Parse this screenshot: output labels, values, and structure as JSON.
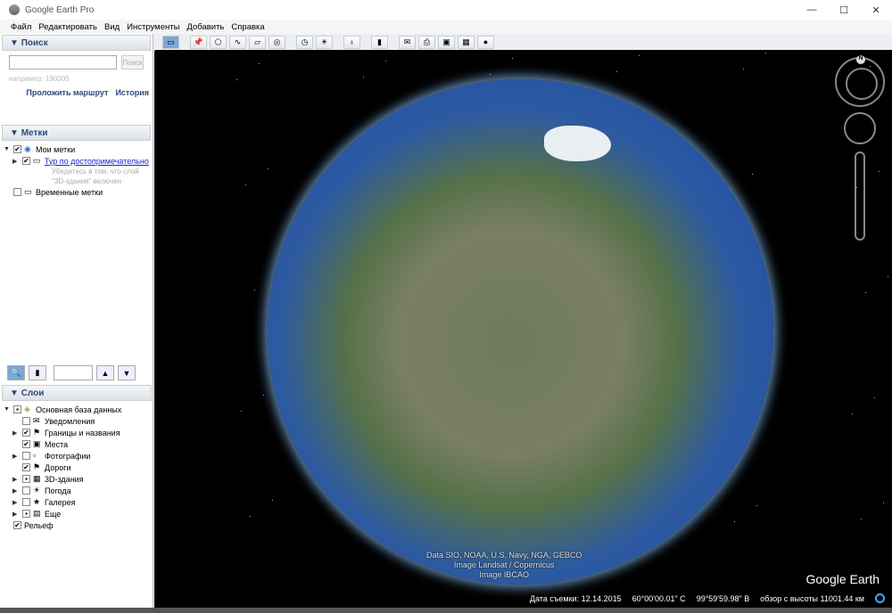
{
  "window": {
    "title": "Google Earth Pro",
    "min": "—",
    "max": "☐",
    "close": "✕"
  },
  "menu": [
    "Файл",
    "Редактировать",
    "Вид",
    "Инструменты",
    "Добавить",
    "Справка"
  ],
  "search": {
    "header": "Поиск",
    "placeholder": "",
    "button": "Поиск",
    "hint": "например: 190005",
    "route": "Проложить маршрут",
    "history": "История"
  },
  "places": {
    "header": "Метки",
    "my": "Мои метки",
    "tour": "Тур по достопримечательностям",
    "tour_note1": "Убедитесь в том, что слой",
    "tour_note2": "\"3D-здания\" включен",
    "temp": "Временные метки"
  },
  "layers": {
    "header": "Слои",
    "root": "Основная база данных",
    "items": [
      {
        "label": "Уведомления",
        "checked": false,
        "arrow": false,
        "icon": "✉"
      },
      {
        "label": "Границы и названия",
        "checked": true,
        "arrow": true,
        "icon": "⚑"
      },
      {
        "label": "Места",
        "checked": true,
        "arrow": false,
        "icon": "▣"
      },
      {
        "label": "Фотографии",
        "checked": false,
        "arrow": true,
        "icon": "▫"
      },
      {
        "label": "Дороги",
        "checked": true,
        "arrow": false,
        "icon": "⚑"
      },
      {
        "label": "3D-здания",
        "checked": "partial",
        "arrow": true,
        "icon": "▦"
      },
      {
        "label": "Погода",
        "checked": false,
        "arrow": true,
        "icon": "☀"
      },
      {
        "label": "Галерея",
        "checked": false,
        "arrow": true,
        "icon": "★"
      },
      {
        "label": "Еще",
        "checked": "partial",
        "arrow": true,
        "icon": "▤"
      }
    ],
    "terrain": "Рельеф"
  },
  "credits": [
    "Data SIO, NOAA, U.S. Navy, NGA, GEBCO",
    "Image Landsat / Copernicus",
    "Image IBCAO"
  ],
  "brand": "Google Earth",
  "status": {
    "date": "Дата съемки: 12.14.2015",
    "lat": "60°00'00.01\" С",
    "lon": "99°59'59.98\" В",
    "alt": "обзор с высоты 11001.44 км"
  },
  "compass": "N"
}
